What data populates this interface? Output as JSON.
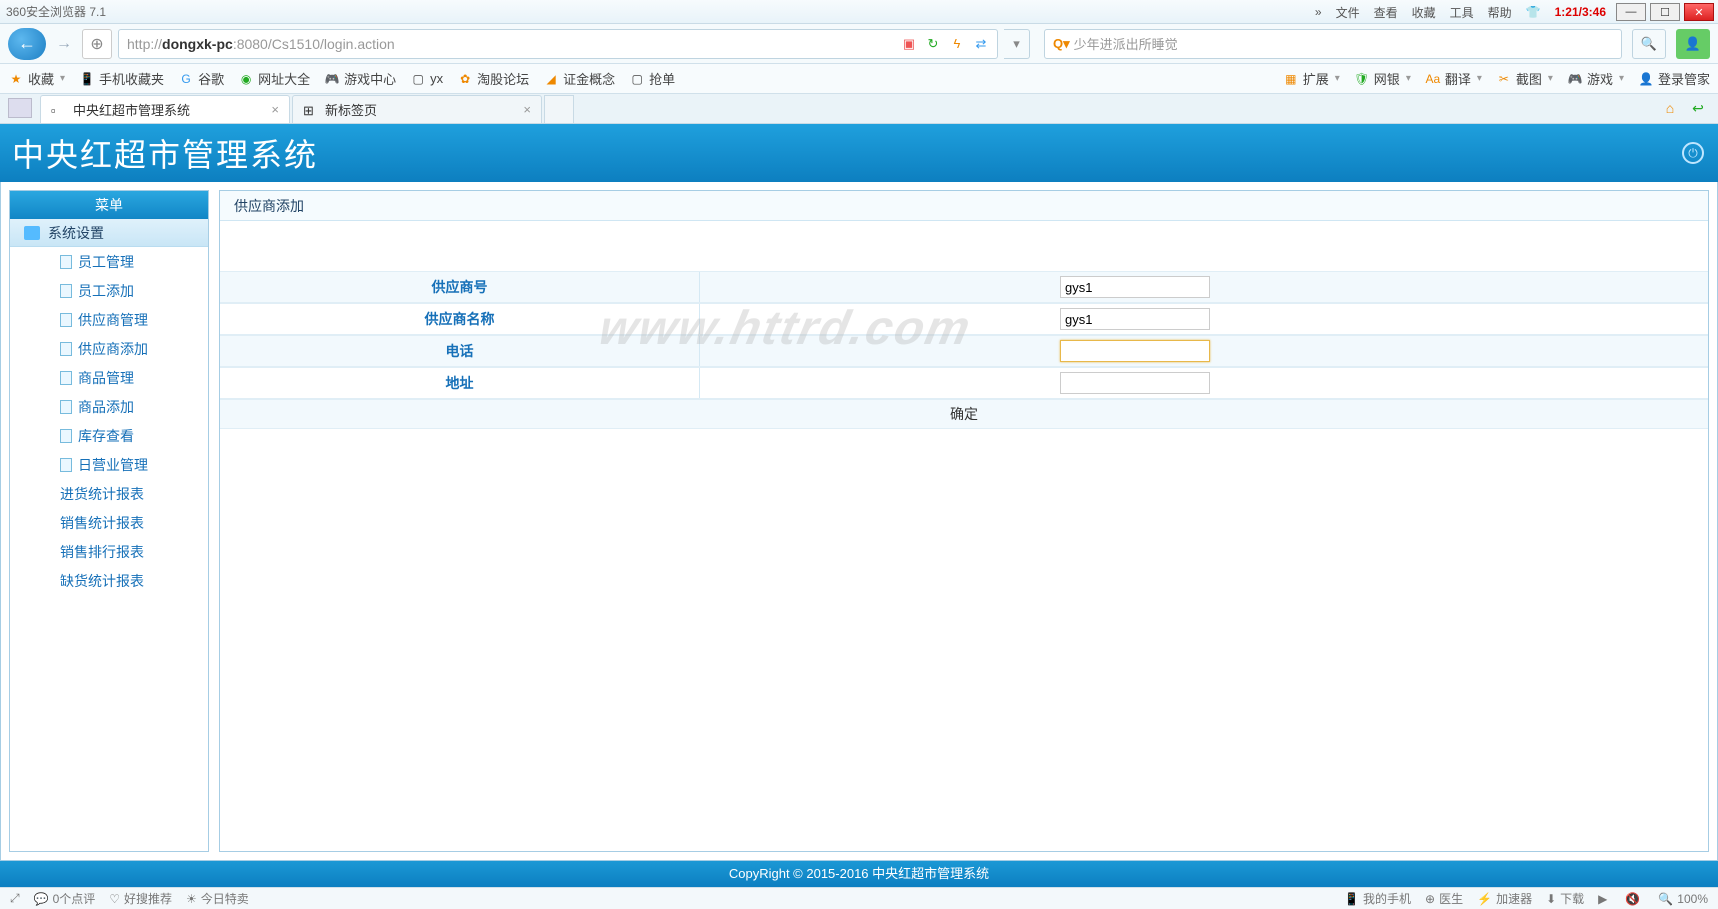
{
  "browser": {
    "title": "360安全浏览器 7.1",
    "clock": "1:21/3:46",
    "menus": [
      "»",
      "文件",
      "查看",
      "收藏",
      "工具",
      "帮助"
    ],
    "url_prefix": "http://",
    "url_host": "dongxk-pc",
    "url_rest": ":8080/Cs1510/login.action",
    "search_placeholder": "少年进派出所睡觉"
  },
  "bookmarks_left": [
    {
      "ico": "★",
      "cls": "ico-orange",
      "label": "收藏",
      "dd": "▾"
    },
    {
      "ico": "📱",
      "cls": "ico-blue",
      "label": "手机收藏夹"
    },
    {
      "ico": "G",
      "cls": "ico-blue",
      "label": "谷歌"
    },
    {
      "ico": "◉",
      "cls": "ico-green",
      "label": "网址大全"
    },
    {
      "ico": "🎮",
      "cls": "",
      "label": "游戏中心"
    },
    {
      "ico": "▢",
      "cls": "",
      "label": "yx"
    },
    {
      "ico": "✿",
      "cls": "ico-orange",
      "label": "淘股论坛"
    },
    {
      "ico": "◢",
      "cls": "ico-orange",
      "label": "证金概念"
    },
    {
      "ico": "▢",
      "cls": "",
      "label": "抢单"
    }
  ],
  "bookmarks_right": [
    {
      "ico": "▦",
      "cls": "ico-orange",
      "label": "扩展",
      "dd": "▾"
    },
    {
      "ico": "🛡",
      "cls": "ico-green",
      "label": "网银",
      "dd": "▾"
    },
    {
      "ico": "Aa",
      "cls": "ico-orange",
      "label": "翻译",
      "dd": "▾"
    },
    {
      "ico": "✂",
      "cls": "ico-orange",
      "label": "截图",
      "dd": "▾"
    },
    {
      "ico": "🎮",
      "cls": "",
      "label": "游戏",
      "dd": "▾"
    },
    {
      "ico": "👤",
      "cls": "ico-blue",
      "label": "登录管家"
    }
  ],
  "tabs": [
    {
      "label": "中央红超市管理系统",
      "active": true
    },
    {
      "label": "新标签页",
      "active": false
    }
  ],
  "app": {
    "title": "中央红超市管理系统",
    "menu_head": "菜单",
    "group": "系统设置",
    "items": [
      {
        "ico": true,
        "label": "员工管理"
      },
      {
        "ico": true,
        "label": "员工添加"
      },
      {
        "ico": true,
        "label": "供应商管理"
      },
      {
        "ico": true,
        "label": "供应商添加"
      },
      {
        "ico": true,
        "label": "商品管理"
      },
      {
        "ico": true,
        "label": "商品添加"
      },
      {
        "ico": true,
        "label": "库存查看"
      },
      {
        "ico": true,
        "label": "日营业管理"
      },
      {
        "ico": false,
        "label": "进货统计报表"
      },
      {
        "ico": false,
        "label": "销售统计报表"
      },
      {
        "ico": false,
        "label": "销售排行报表"
      },
      {
        "ico": false,
        "label": "缺货统计报表"
      }
    ],
    "content_title": "供应商添加",
    "form": {
      "supplier_no_label": "供应商号",
      "supplier_no_value": "gys1",
      "supplier_name_label": "供应商名称",
      "supplier_name_value": "gys1",
      "phone_label": "电话",
      "phone_value": "",
      "address_label": "地址",
      "address_value": "",
      "submit": "确定"
    },
    "watermark": "www.httrd.com",
    "footer": "CopyRight © 2015-2016 中央红超市管理系统"
  },
  "status_left": [
    {
      "ico": "💬",
      "label": "0个点评"
    },
    {
      "ico": "♡",
      "label": "好搜推荐"
    },
    {
      "ico": "☀",
      "label": "今日特卖"
    }
  ],
  "status_right": [
    {
      "ico": "📱",
      "label": "我的手机"
    },
    {
      "ico": "⊕",
      "label": "医生"
    },
    {
      "ico": "⚡",
      "label": "加速器"
    },
    {
      "ico": "⬇",
      "label": "下载"
    },
    {
      "ico": "▶",
      "label": ""
    },
    {
      "ico": "🔇",
      "label": ""
    },
    {
      "ico": "🔍",
      "label": "100%"
    }
  ]
}
